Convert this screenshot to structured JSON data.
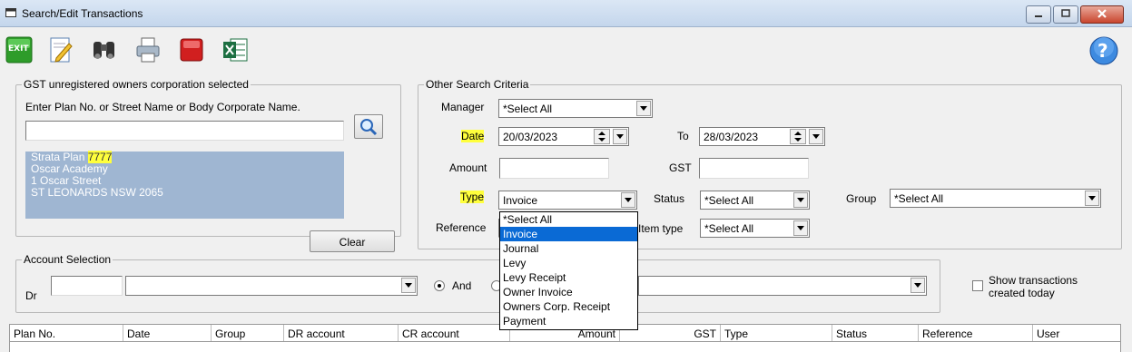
{
  "window": {
    "title": "Search/Edit Transactions"
  },
  "toolbar": {
    "exit_label": "EXIT",
    "buttons": [
      "exit-icon",
      "edit-icon",
      "binoculars-icon",
      "printer-icon",
      "stop-icon",
      "excel-icon"
    ],
    "help_label": "?"
  },
  "gst_group": {
    "legend": "GST unregistered owners corporation selected",
    "prompt": "Enter Plan No. or Street Name or Body Corporate Name.",
    "search_value": "",
    "address_prefix": "Strata Plan ",
    "address_plan_no": "7777",
    "address_lines": [
      "Oscar Academy",
      "1 Oscar Street",
      "ST LEONARDS  NSW  2065"
    ],
    "clear_label": "Clear"
  },
  "criteria": {
    "legend": "Other Search Criteria",
    "manager_label": "Manager",
    "manager_value": "*Select All",
    "date_label": "Date",
    "date_from": "20/03/2023",
    "to_label": "To",
    "date_to": "28/03/2023",
    "amount_label": "Amount",
    "amount_value": "",
    "gst_label": "GST",
    "gst_value": "",
    "type_label": "Type",
    "type_value": "Invoice",
    "status_label": "Status",
    "status_value": "*Select All",
    "group_label": "Group",
    "group_value": "*Select All",
    "reference_label": "Reference",
    "item_type_label": "Item type",
    "item_type_value": "*Select All"
  },
  "type_dropdown": {
    "options": [
      "*Select All",
      "Invoice",
      "Journal",
      "Levy",
      "Levy Receipt",
      "Owner Invoice",
      "Owners Corp. Receipt",
      "Payment"
    ],
    "selected": "Invoice"
  },
  "account": {
    "legend": "Account Selection",
    "dr_label": "Dr",
    "and_label": "And",
    "show_today_line1": "Show transactions",
    "show_today_line2": "created today"
  },
  "grid": {
    "columns": [
      "Plan No.",
      "Date",
      "Group",
      "DR account",
      "CR account",
      "Amount",
      "GST",
      "Type",
      "Status",
      "Reference",
      "User"
    ]
  },
  "colors": {
    "highlight": "#ffff3c",
    "address_bg": "#9fb6d2",
    "selection": "#0a6ad5"
  }
}
